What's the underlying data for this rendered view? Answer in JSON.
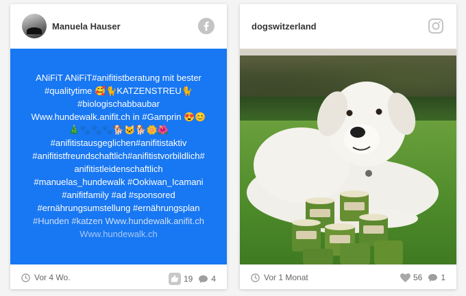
{
  "posts": [
    {
      "username": "Manuela Hauser",
      "platform_icon": "facebook-icon",
      "text_lines": [
        "ANiFiT ANiFiT#anifitistberatung mit bester",
        "#qualitytime 🥰🐈KATZENSTREU🐈",
        "#biologischabbaubar",
        "Www.hundewalk.anifit.ch in #Gamprin 😍😊",
        "🎄🐾🐾🐾🐕🐱🐕🌼🌺",
        "#anifitistausgeglichen#anifitistaktiv",
        "#anifitistfreundschaftlich#anifitistvorbildlich#",
        "anifitistleidenschaftlich",
        "#manuelas_hundewalk #Ookiwan_Icamani",
        "#anifitfamily #ad #sponsored",
        "#ernährungsumstellung #ernährungsplan",
        "#Hunden #katzen Www.hundewalk.anifit.ch",
        "Www.hundewalk.ch"
      ],
      "time": "Vor 4 Wo.",
      "likes": "19",
      "comments": "4",
      "background_color": "#1877f2"
    },
    {
      "username": "dogswitzerland",
      "platform_icon": "instagram-icon",
      "image_alt": "White dog lying on grass next to stacked cans of dog food",
      "time": "Vor 1 Monat",
      "likes": "56",
      "comments": "1"
    }
  ]
}
